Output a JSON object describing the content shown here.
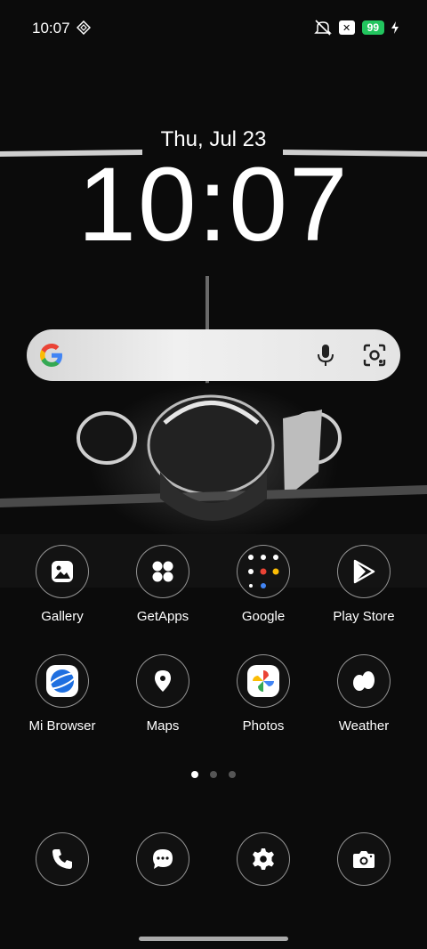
{
  "status": {
    "time": "10:07",
    "battery": "99"
  },
  "lockclock": {
    "date": "Thu, Jul 23",
    "time": "10:07"
  },
  "apps": [
    {
      "label": "Gallery",
      "icon": "gallery-icon"
    },
    {
      "label": "GetApps",
      "icon": "getapps-icon"
    },
    {
      "label": "Google",
      "icon": "google-folder-icon"
    },
    {
      "label": "Play Store",
      "icon": "play-store-icon"
    },
    {
      "label": "Mi Browser",
      "icon": "mi-browser-icon"
    },
    {
      "label": "Maps",
      "icon": "maps-icon"
    },
    {
      "label": "Photos",
      "icon": "photos-icon"
    },
    {
      "label": "Weather",
      "icon": "weather-icon"
    }
  ],
  "pager": {
    "pages": 3,
    "active": 1
  },
  "dock": [
    "phone-icon",
    "messages-icon",
    "settings-icon",
    "camera-icon"
  ],
  "colors": {
    "battery": "#22c55e",
    "background": "#0b0b0b"
  }
}
